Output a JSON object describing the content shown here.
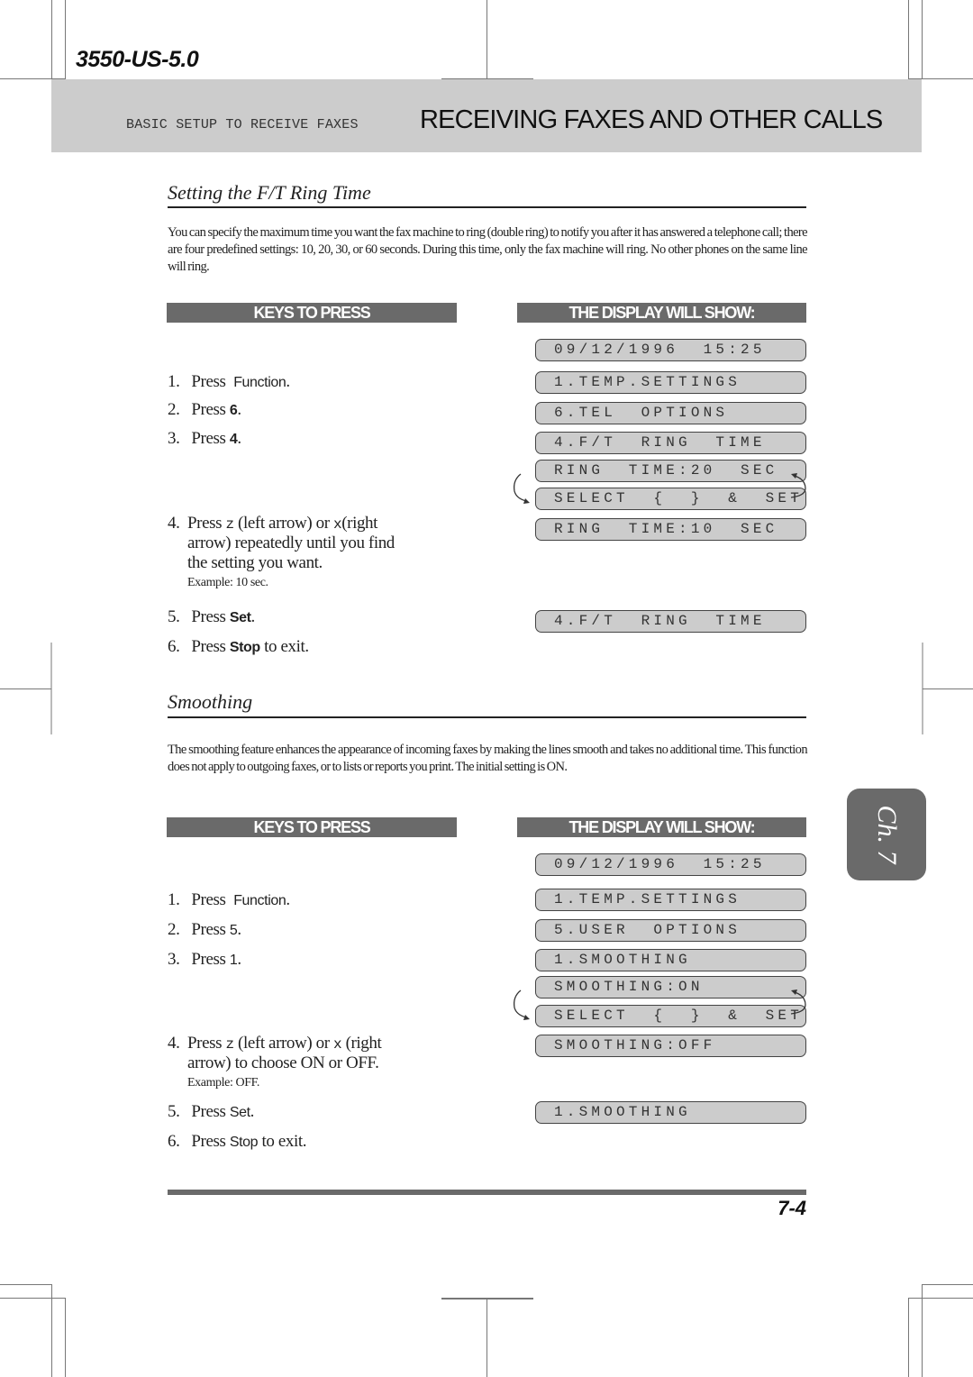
{
  "header": {
    "model_code": "3550-US-5.0",
    "section_label": "BASIC SETUP TO RECEIVE FAXES",
    "chapter_title": "RECEIVING FAXES AND OTHER CALLS"
  },
  "sections": [
    {
      "title": "Setting the F/T Ring Time",
      "intro": "You can specify the maximum time you want the fax machine to ring (double ring) to notify you after it has answered a telephone call; there are four predefined settings: 10, 20, 30, or 60 seconds. During this time, only the fax machine will ring. No other phones on the same line will ring.",
      "keys_header": "KEYS TO PRESS",
      "display_header": "THE DISPLAY WILL SHOW:",
      "steps": [
        {
          "num": "1.",
          "text": "Press",
          "key": "Function",
          "after": "."
        },
        {
          "num": "2.",
          "text": "Press",
          "key": "6",
          "after": "."
        },
        {
          "num": "3.",
          "text": "Press",
          "key": "4",
          "after": "."
        },
        {
          "num": "4.",
          "line1_a": "Press",
          "z": "z",
          "line1_b": "(left arrow) or",
          "x": "x",
          "line1_c": "(right",
          "line2": "arrow) repeatedly until you find",
          "line3": "the setting you want.",
          "example": "Example: 10 sec."
        },
        {
          "num": "5.",
          "text": "Press",
          "key": "Set",
          "after": "."
        },
        {
          "num": "6.",
          "text": "Press",
          "key": "Stop",
          "after": "to exit."
        }
      ],
      "display": [
        "09/12/1996  15:25",
        "1.TEMP.SETTINGS",
        "6.TEL  OPTIONS",
        "4.F/T  RING  TIME",
        "RING  TIME:20  SEC",
        "SELECT  {  }  &  SET",
        "RING  TIME:10  SEC",
        "4.F/T  RING  TIME"
      ]
    },
    {
      "title": "Smoothing",
      "intro": "The smoothing feature enhances the appearance of incoming faxes by making the lines smooth and takes no additional time. This function does not apply to outgoing faxes, or to lists or reports you print. The initial setting is ON.",
      "keys_header": "KEYS TO PRESS",
      "display_header": "THE DISPLAY WILL SHOW:",
      "steps": [
        {
          "num": "1.",
          "text": "Press",
          "key": "Function",
          "after": "."
        },
        {
          "num": "2.",
          "text": "Press",
          "key": "5",
          "after": "."
        },
        {
          "num": "3.",
          "text": "Press",
          "key": "1",
          "after": "."
        },
        {
          "num": "4.",
          "line1_a": "Press",
          "z": "z",
          "line1_b": "(left arrow) or",
          "x": "x",
          "line1_c": "(right",
          "line2": "arrow) to choose ON or OFF.",
          "example": "Example: OFF."
        },
        {
          "num": "5.",
          "text": "Press",
          "key": "Set",
          "after": "."
        },
        {
          "num": "6.",
          "text": "Press",
          "key": "Stop",
          "after": "to exit."
        }
      ],
      "display": [
        "09/12/1996  15:25",
        "1.TEMP.SETTINGS",
        "5.USER  OPTIONS",
        "1.SMOOTHING",
        "SMOOTHING:ON",
        "SELECT  {  }  &  SET",
        "SMOOTHING:OFF",
        "1.SMOOTHING"
      ]
    }
  ],
  "chapter_tab": "Ch. 7",
  "page_number": "7-4",
  "colors": {
    "header_bar": "#cccccc",
    "column_header": "#6a6a6a",
    "lcd_background": "#cccccc",
    "chapter_tab": "#6a6a6a"
  }
}
